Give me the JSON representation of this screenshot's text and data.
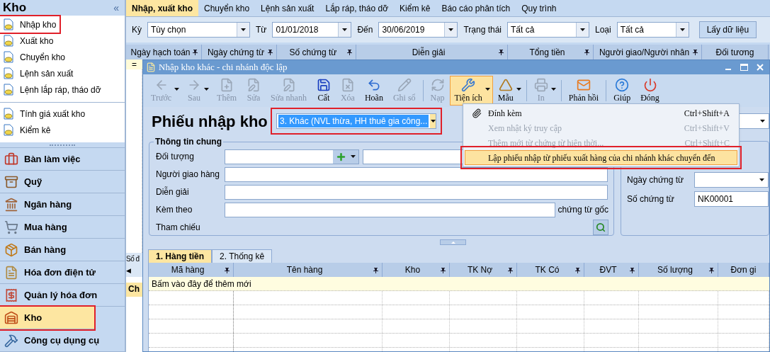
{
  "sidebar": {
    "title": "Kho",
    "collapse": "«",
    "groups": [
      [
        {
          "label": "Nhập kho",
          "highlighted": true
        },
        {
          "label": "Xuất kho",
          "highlighted": false
        },
        {
          "label": "Chuyển kho",
          "highlighted": false
        },
        {
          "label": "Lệnh sản xuất",
          "highlighted": false
        },
        {
          "label": "Lệnh lắp ráp, tháo dỡ",
          "highlighted": false
        }
      ],
      [
        {
          "label": "Tính giá xuất kho",
          "highlighted": false
        },
        {
          "label": "Kiểm kê",
          "highlighted": false
        }
      ]
    ],
    "modules": [
      {
        "label": "Bàn làm việc",
        "selected": false,
        "highlighted": false
      },
      {
        "label": "Quỹ",
        "selected": false,
        "highlighted": false
      },
      {
        "label": "Ngân hàng",
        "selected": false,
        "highlighted": false
      },
      {
        "label": "Mua hàng",
        "selected": false,
        "highlighted": false
      },
      {
        "label": "Bán hàng",
        "selected": false,
        "highlighted": false
      },
      {
        "label": "Hóa đơn điện tử",
        "selected": false,
        "highlighted": false
      },
      {
        "label": "Quản lý hóa đơn",
        "selected": false,
        "highlighted": false
      },
      {
        "label": "Kho",
        "selected": true,
        "highlighted": true
      },
      {
        "label": "Công cụ dụng cụ",
        "selected": false,
        "highlighted": false
      }
    ]
  },
  "tabs": [
    {
      "label": "Nhập, xuất kho",
      "selected": true
    },
    {
      "label": "Chuyển kho",
      "selected": false
    },
    {
      "label": "Lệnh sản xuất",
      "selected": false
    },
    {
      "label": "Lắp ráp, tháo dỡ",
      "selected": false
    },
    {
      "label": "Kiểm kê",
      "selected": false
    },
    {
      "label": "Báo cáo phân tích",
      "selected": false
    },
    {
      "label": "Quy trình",
      "selected": false
    }
  ],
  "filters": [
    {
      "label": "Kỳ",
      "value": "Tùy chọn"
    },
    {
      "label": "Từ",
      "value": "01/01/2018"
    },
    {
      "label": "Đến",
      "value": "30/06/2019"
    },
    {
      "label": "Trạng thái",
      "value": "Tất cả"
    },
    {
      "label": "Loại",
      "value": "Tất cả"
    }
  ],
  "fetch_button": "Lấy dữ liệu",
  "list_columns": [
    "Ngày hạch toán",
    "Ngày chứng từ",
    "Số chứng từ",
    "Diễn giải",
    "Tổng tiền",
    "Người giao/Người nhân",
    "Đối tương"
  ],
  "list_strip": {
    "marker": "=",
    "footer": "Số đ",
    "scroll": "◀",
    "panel_tab": "Ch"
  },
  "dialog": {
    "title": "Nhập kho khác - chi nhánh độc lập",
    "toolbar": [
      {
        "label": "Trước",
        "disabled": true,
        "dropdown": true,
        "active": false
      },
      {
        "label": "Sau",
        "disabled": true,
        "dropdown": true,
        "active": false
      },
      {
        "label": "Thêm",
        "disabled": true,
        "dropdown": false,
        "active": false
      },
      {
        "label": "Sửa",
        "disabled": true,
        "dropdown": false,
        "active": false
      },
      {
        "label": "Sửa nhanh",
        "disabled": true,
        "dropdown": false,
        "active": false
      },
      {
        "label": "Cất",
        "disabled": false,
        "dropdown": false,
        "active": false
      },
      {
        "label": "Xóa",
        "disabled": true,
        "dropdown": false,
        "active": false
      },
      {
        "label": "Hoãn",
        "disabled": false,
        "dropdown": false,
        "active": false
      },
      {
        "label": "Ghi sổ",
        "disabled": true,
        "dropdown": false,
        "active": false
      },
      {
        "label": "Nạp",
        "disabled": true,
        "dropdown": false,
        "active": false
      },
      {
        "label": "Tiện ích",
        "disabled": false,
        "dropdown": true,
        "active": true
      },
      {
        "label": "Mẫu",
        "disabled": false,
        "dropdown": true,
        "active": false
      },
      {
        "label": "In",
        "disabled": true,
        "dropdown": true,
        "active": false
      },
      {
        "label": "Phản hồi",
        "disabled": false,
        "dropdown": false,
        "active": false
      },
      {
        "label": "Giúp",
        "disabled": false,
        "dropdown": false,
        "active": false
      },
      {
        "label": "Đóng",
        "disabled": false,
        "dropdown": false,
        "active": false
      }
    ],
    "heading": "Phiếu nhập kho",
    "voucher_type": {
      "value": "3. Khác (NVL thừa, HH thuê gia công...",
      "highlighted": true
    },
    "general_group": {
      "title": "Thông tin chung",
      "fields": [
        {
          "label": "Đối tượng",
          "kind": "lookup"
        },
        {
          "label": "Người giao hàng",
          "kind": "text"
        },
        {
          "label": "Diễn giải",
          "kind": "text"
        },
        {
          "label": "Kèm theo",
          "kind": "attach",
          "suffix": "chứng từ gốc"
        },
        {
          "label": "Tham chiếu",
          "kind": "reference"
        }
      ]
    },
    "right_fields": [
      {
        "label": "Ngày chứng từ",
        "kind": "date"
      },
      {
        "label": "Số chứng từ",
        "kind": "text",
        "value": "NK00001"
      }
    ],
    "detail_tabs": [
      {
        "label": "1. Hàng tiền",
        "selected": true
      },
      {
        "label": "2. Thống kê",
        "selected": false
      }
    ],
    "detail_columns": [
      "Mã hàng",
      "Tên hàng",
      "Kho",
      "TK Nợ",
      "TK Có",
      "ĐVT",
      "Số lượng",
      "Đơn gi"
    ],
    "new_row_hint": "Bấm vào đây để thêm mới",
    "menu": [
      {
        "label": "Đính kèm",
        "shortcut": "Ctrl+Shift+A",
        "disabled": false,
        "selected": false,
        "highlighted": false
      },
      {
        "label": "Xem nhật ký truy cập",
        "shortcut": "Ctrl+Shift+V",
        "disabled": true,
        "selected": false,
        "highlighted": false
      },
      {
        "label": "Thêm mới từ chứng từ hiện thời...",
        "shortcut": "Ctrl+Shift+C",
        "disabled": true,
        "selected": false,
        "highlighted": false
      },
      {
        "label": "Lập phiếu nhập từ phiếu xuất hàng của chi nhánh khác chuyển đến",
        "disabled": false,
        "selected": true,
        "highlighted": true
      }
    ]
  }
}
